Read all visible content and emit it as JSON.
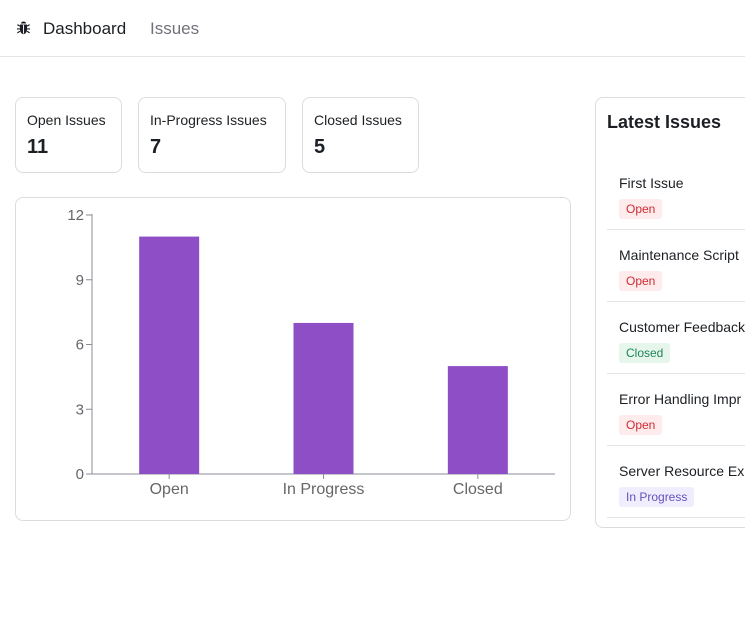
{
  "nav": {
    "logo_icon": "bug-icon",
    "links": [
      {
        "label": "Dashboard",
        "active": true
      },
      {
        "label": "Issues",
        "active": false
      }
    ]
  },
  "summary": [
    {
      "label": "Open Issues",
      "value": "11"
    },
    {
      "label": "In-Progress Issues",
      "value": "7"
    },
    {
      "label": "Closed Issues",
      "value": "5"
    }
  ],
  "chart_data": {
    "type": "bar",
    "categories": [
      "Open",
      "In Progress",
      "Closed"
    ],
    "values": [
      11,
      7,
      5
    ],
    "ylim": [
      0,
      12
    ],
    "yticks": [
      0,
      3,
      6,
      9,
      12
    ],
    "bar_color": "#8e4ec6",
    "grid": false
  },
  "latest": {
    "title": "Latest Issues",
    "items": [
      {
        "title": "First Issue",
        "status": "Open"
      },
      {
        "title": "Maintenance Script",
        "status": "Open"
      },
      {
        "title": "Customer Feedback",
        "status": "Closed"
      },
      {
        "title": "Error Handling Impr",
        "status": "Open"
      },
      {
        "title": "Server Resource Ex",
        "status": "In Progress"
      }
    ]
  },
  "status_colors": {
    "Open": {
      "bg": "#feebec",
      "fg": "#ce2c31"
    },
    "Closed": {
      "bg": "#e6f6eb",
      "fg": "#218358"
    },
    "In Progress": {
      "bg": "#f0eefe",
      "fg": "#6550b9"
    }
  }
}
